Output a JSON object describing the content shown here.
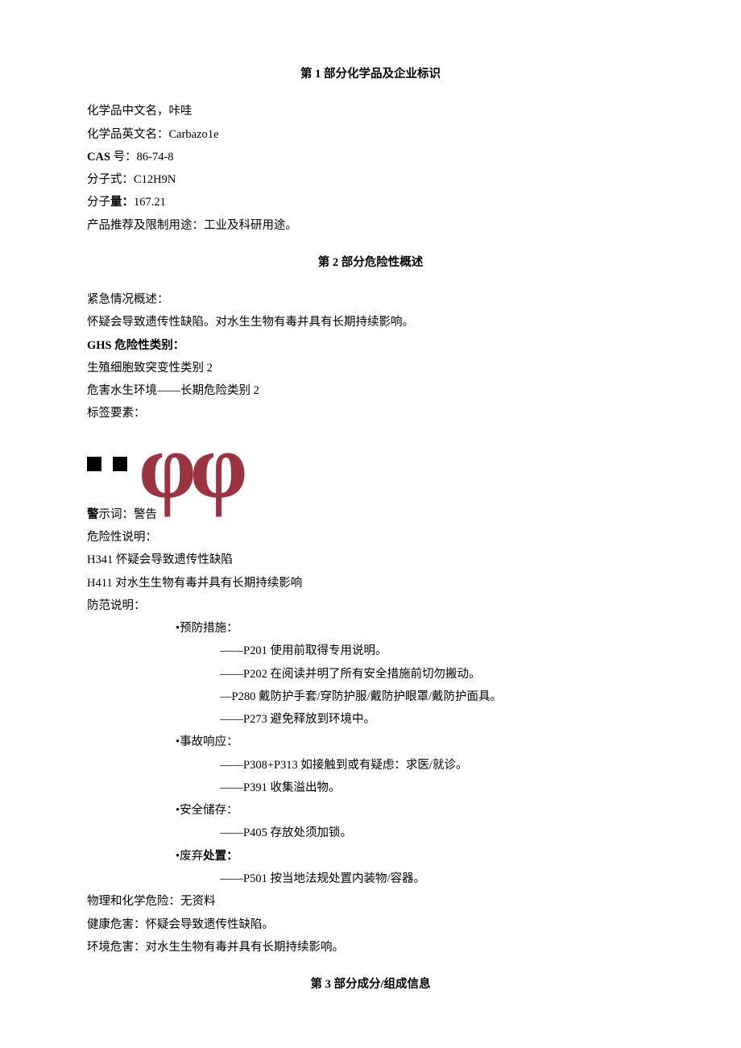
{
  "section1": {
    "title_prefix": "第",
    "title_num": "1",
    "title_suffix": "部分化学品及企业标识",
    "name_cn_label": "化学品中文名，",
    "name_cn": "咔哇",
    "name_en_label": "化学品英文名：",
    "name_en_prefix": "Carbazo",
    "name_en_suffix": "1e",
    "cas_label": "CAS",
    "cas_sep": "号：",
    "cas": "86-74-8",
    "formula_label": "分子式：",
    "formula": "C12H9N",
    "mw_label_a": "分子",
    "mw_label_b": "量：",
    "mw": "167.21",
    "use": "产品推荐及限制用途：工业及科研用途。"
  },
  "section2": {
    "title_prefix": "第",
    "title_num": "2",
    "title_suffix": "部分危险性概述",
    "emerg_label": "紧急情况概述：",
    "emerg_text": "怀疑会导致遗传性缺陷。对水生生物有毒并具有长期持续影响。",
    "ghs_label_a": "GHS",
    "ghs_label_b": "危险性类别：",
    "ghs_1": "生殖细胞致突变性类别 2",
    "ghs_2": "危害水生环境——长期危险类别 2",
    "label_elem": "标签要素：",
    "signal_label_a": "警",
    "signal_label_b": "示词：",
    "signal": "警告",
    "hazard_label": "危险性说明：",
    "h341": "H341 怀疑会导致遗传性缺陷",
    "h411": "H411 对水生生物有毒并具有长期持续影响",
    "precaution_label": "防范说明：",
    "prevent": {
      "title": "•预防措施：",
      "p201": "——P201 使用前取得专用说明。",
      "p202": "——P202 在阅读并明了所有安全措施前切勿搬动。",
      "p280": "—P280 戴防护手套/穿防护服/戴防护眼罩/戴防护面具。",
      "p273": "——P273 避免释放到环境中。"
    },
    "response": {
      "title": "•事故响应：",
      "p308": "——P308+P313 如接触到或有疑虑：求医/就诊。",
      "p391": "——P391 收集溢出物。"
    },
    "storage": {
      "title": "•安全储存：",
      "p405": "——P405 存放处须加锁。"
    },
    "disposal": {
      "title_a": "•废弃",
      "title_b": "处置：",
      "p501": "——P501 按当地法规处置内装物/容器。"
    },
    "phys": "物理和化学危险：无资料",
    "health": "健康危害：怀疑会导致遗传性缺陷。",
    "env": "环境危害：对水生生物有毒并具有长期持续影响。"
  },
  "section3": {
    "title_prefix": "第",
    "title_num": "3",
    "title_suffix": "部分成分/组成信息"
  }
}
